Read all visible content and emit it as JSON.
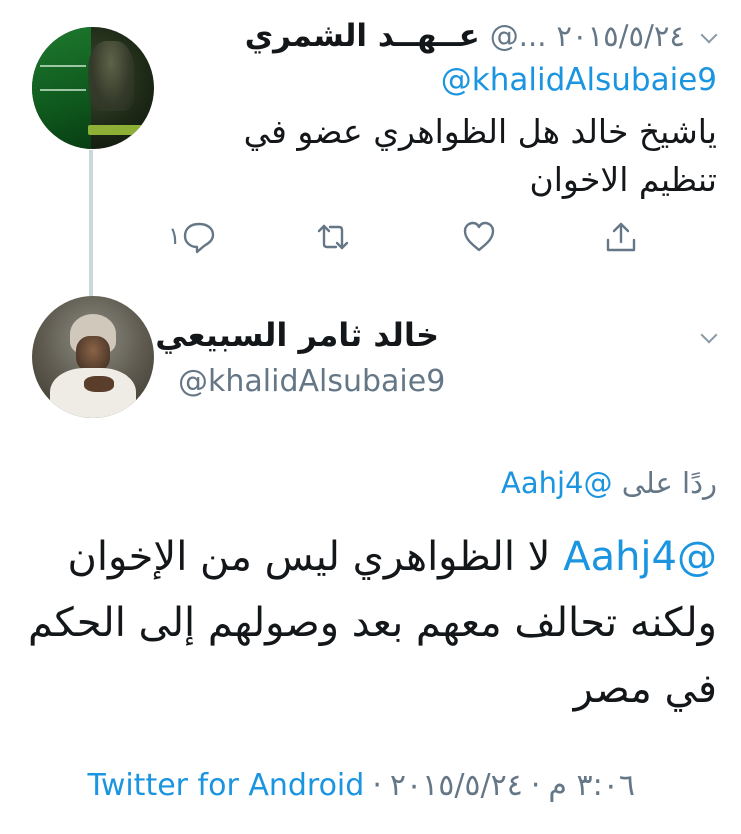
{
  "reply_tweet": {
    "author_name": "عــهــد الشمري",
    "handle": "@...",
    "date": "٢٠١٥/٥/٢٤",
    "mention": "@khalidAlsubaie9",
    "text": "ياشيخ خالد هل الظواهري عضو في تنظيم الاخوان",
    "actions": {
      "reply_count": "١",
      "reply_icon": "reply-icon",
      "retweet_icon": "retweet-icon",
      "like_icon": "heart-icon",
      "share_icon": "share-icon"
    }
  },
  "main_tweet": {
    "author_name": "خالد ثامر السبيعي",
    "handle": "@khalidAlsubaie9",
    "replying_label": "ردًا على",
    "replying_to": "@Aahj4",
    "text_mention": "@Aahj4",
    "text_line1": "لا الظواهري ليس من الإخوان",
    "text_line2": "ولكنه تحالف معهم بعد وصولهم إلى الحكم",
    "text_line3": "في مصر",
    "time": "٣:٠٦ م",
    "date": "٢٠١٥/٥/٢٤",
    "separator": "·",
    "source": "Twitter for Android"
  },
  "colors": {
    "link": "#1b95e0",
    "secondary_text": "#657786",
    "primary_text": "#14171a",
    "thread_line": "#ccd6dd"
  }
}
